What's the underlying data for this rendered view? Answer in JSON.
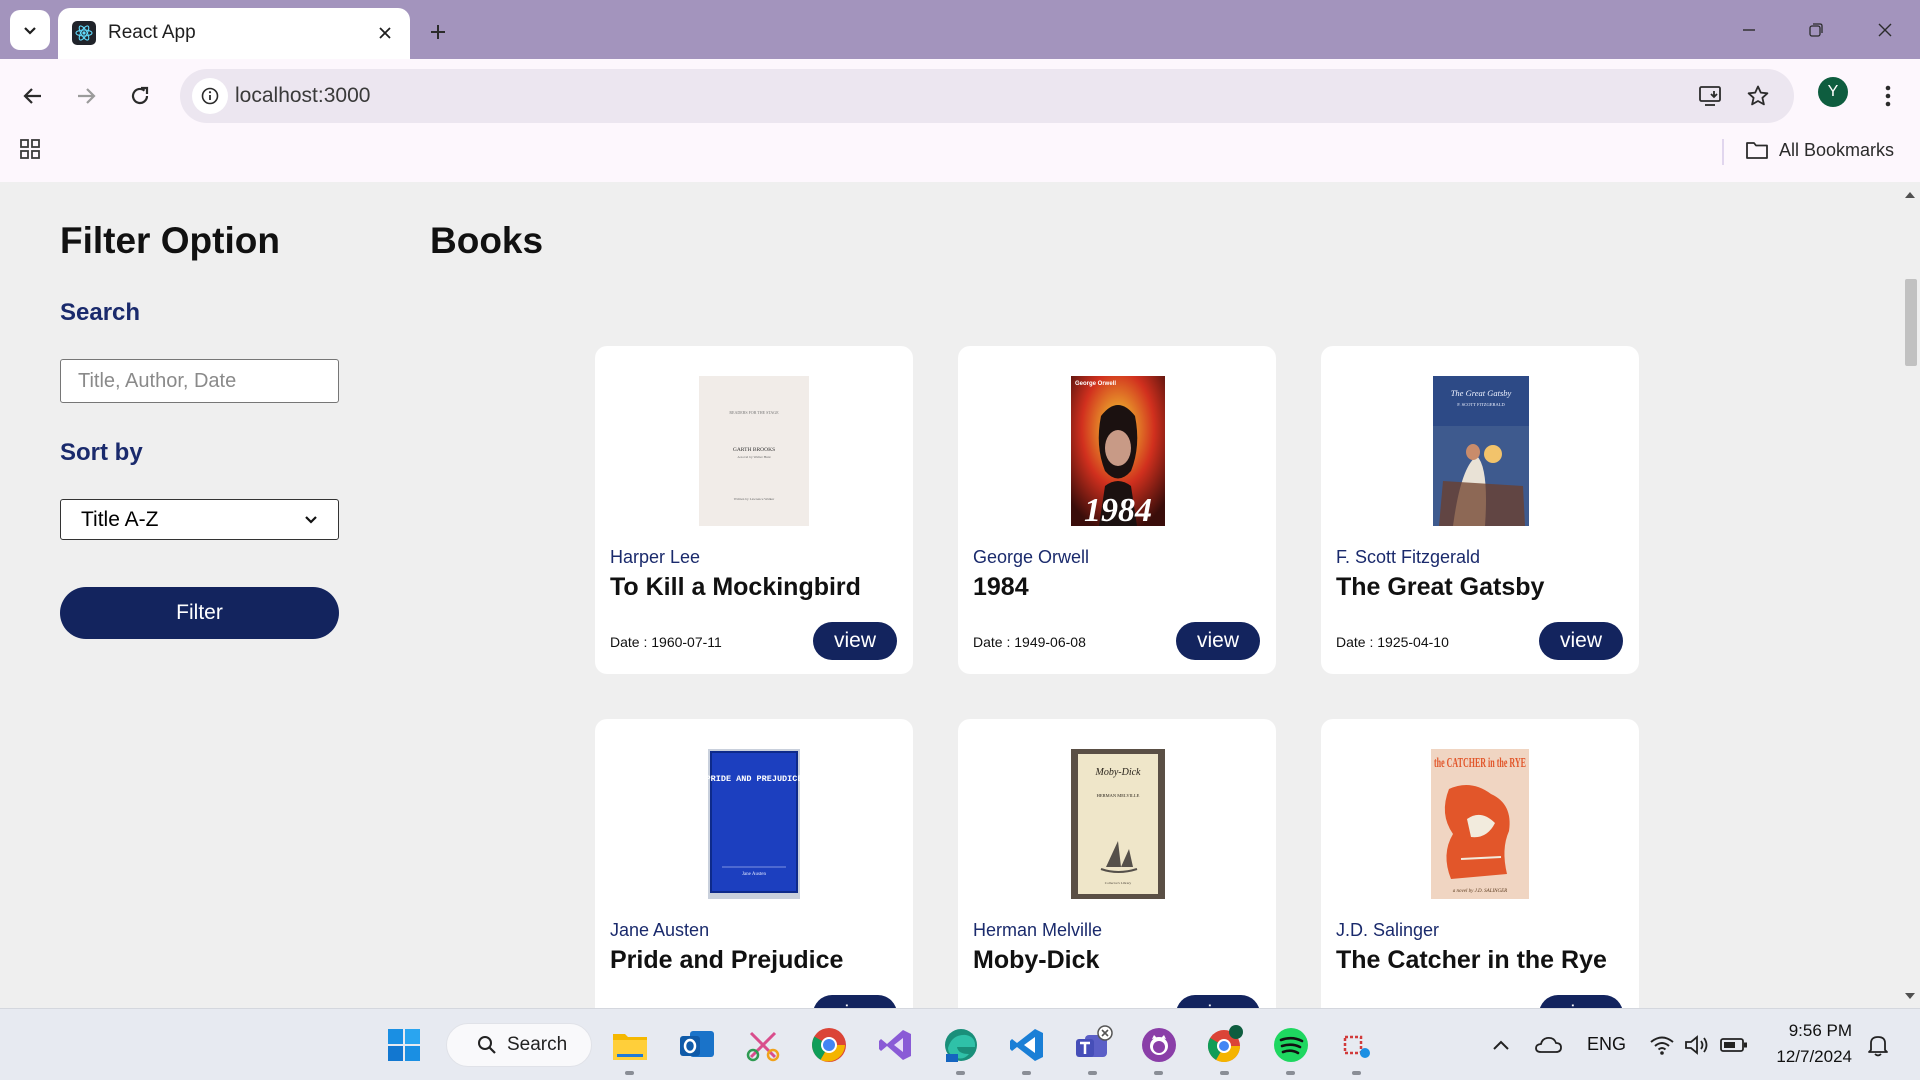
{
  "browser": {
    "tab_title": "React App",
    "url": "localhost:3000",
    "profile_initial": "Y",
    "bookmarks_label": "All Bookmarks"
  },
  "sidebar": {
    "heading": "Filter Option",
    "search_label": "Search",
    "search_placeholder": "Title, Author, Date",
    "search_value": "",
    "sort_label": "Sort by",
    "sort_selected": "Title A-Z",
    "filter_button": "Filter"
  },
  "main": {
    "heading": "Books",
    "date_prefix": "Date : ",
    "view_label": "view",
    "books": [
      {
        "author": "Harper Lee",
        "title": "To Kill a Mockingbird",
        "date": "Date : 1960-07-11",
        "cover": "mockingbird-cover"
      },
      {
        "author": "George Orwell",
        "title": "1984",
        "date": "Date : 1949-06-08",
        "cover": "1984-cover"
      },
      {
        "author": "F. Scott Fitzgerald",
        "title": "The Great Gatsby",
        "date": "Date : 1925-04-10",
        "cover": "gatsby-cover"
      },
      {
        "author": "Jane Austen",
        "title": "Pride and Prejudice",
        "date": "",
        "cover": "pride-cover"
      },
      {
        "author": "Herman Melville",
        "title": "Moby-Dick",
        "date": "",
        "cover": "mobydick-cover"
      },
      {
        "author": "J.D. Salinger",
        "title": "The Catcher in the Rye",
        "date": "",
        "cover": "catcher-cover"
      }
    ]
  },
  "covers": {
    "mockingbird": {
      "line1": "READERS FOR THE STAGE",
      "line2": "GARTH BROOKS",
      "line3": "A novel by Walter Hunt",
      "line4": "Written by Lawrence Walker"
    },
    "orwell": {
      "author": "George Orwell",
      "title": "1984"
    },
    "gatsby": {
      "title": "The Great Gatsby",
      "author": "F. SCOTT FITZGERALD"
    },
    "pride": {
      "title": "PRIDE AND PREJUDICE",
      "author": "Jane Austen"
    },
    "moby": {
      "title": "Moby-Dick",
      "author": "HERMAN MELVILLE",
      "imprint": "Collector's Library"
    },
    "catcher": {
      "title": "the CATCHER in the RYE",
      "author": "a novel by J.D. SALINGER"
    }
  },
  "taskbar": {
    "search_label": "Search",
    "language": "ENG",
    "time": "9:56 PM",
    "date": "12/7/2024"
  },
  "colors": {
    "accent": "#13245e",
    "label": "#1a2a6c",
    "titlebar": "#a394bd",
    "page_bg": "#efefef"
  }
}
